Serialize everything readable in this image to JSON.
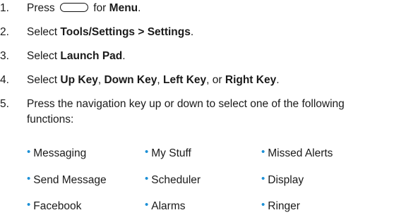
{
  "steps": {
    "s1": {
      "num": "1.",
      "pre": "Press",
      "mid": "for",
      "bold": "Menu",
      "post": "."
    },
    "s2": {
      "num": "2.",
      "pre": "Select",
      "bold": "Tools/Settings > Settings",
      "post": "."
    },
    "s3": {
      "num": "3.",
      "pre": "Select",
      "bold": "Launch Pad",
      "post": "."
    },
    "s4": {
      "num": "4.",
      "pre": "Select",
      "b1": "Up Key",
      "c1": ",",
      "b2": "Down Key",
      "c2": ",",
      "b3": "Left Key",
      "c3": ", or",
      "b4": "Right Key",
      "post": "."
    },
    "s5": {
      "num": "5.",
      "line1": "Press the navigation key up or down to select one of the following",
      "line2": "functions:"
    }
  },
  "functions": {
    "col1": [
      "Messaging",
      "Send Message",
      "Facebook"
    ],
    "col2": [
      "My Stuff",
      "Scheduler",
      "Alarms"
    ],
    "col3": [
      "Missed Alerts",
      "Display",
      "Ringer"
    ]
  },
  "icons": {
    "softkey": "softkey-oval-icon",
    "bullet": "bullet-icon"
  },
  "colors": {
    "bullet": "#1c90d6",
    "text": "#1a1a1a"
  }
}
